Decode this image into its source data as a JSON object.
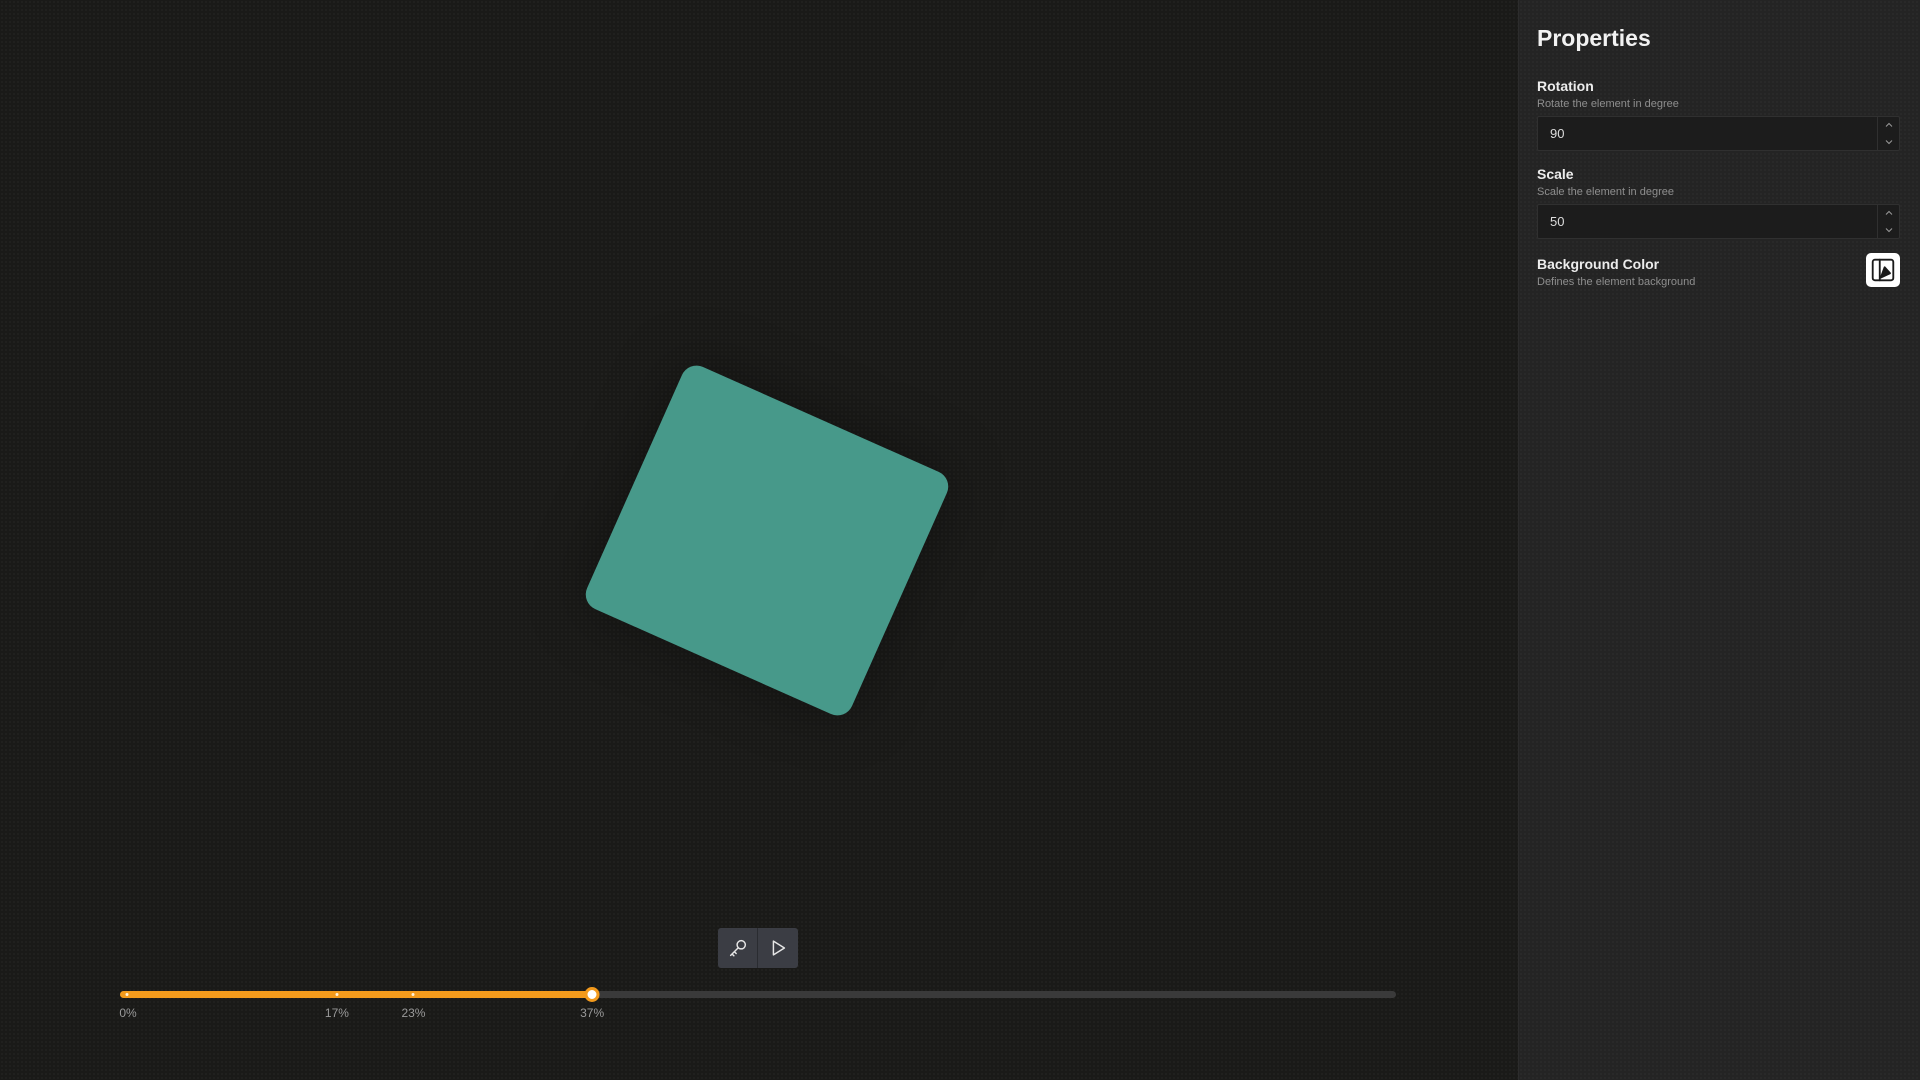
{
  "colors": {
    "shape": "#47998a",
    "accent": "#f39a1c",
    "panel_bg": "#242424",
    "canvas_bg": "#1a1a18"
  },
  "canvas": {
    "shape_name": "animated-square"
  },
  "toolbar": {
    "keyframe_icon": "key-icon",
    "play_icon": "play-icon"
  },
  "timeline": {
    "progress": 0.37,
    "keyframes": [
      {
        "position": 0.0,
        "label": "0%"
      },
      {
        "position": 0.17,
        "label": "17%"
      },
      {
        "position": 0.23,
        "label": "23%"
      },
      {
        "position": 0.37,
        "label": "37%"
      }
    ]
  },
  "properties": {
    "title": "Properties",
    "rotation": {
      "label": "Rotation",
      "description": "Rotate the element in degree",
      "value": "90"
    },
    "scale": {
      "label": "Scale",
      "description": "Scale the element in degree",
      "value": "50"
    },
    "background": {
      "label": "Background Color",
      "description": "Defines the element background",
      "icon": "color-picker-icon"
    }
  }
}
